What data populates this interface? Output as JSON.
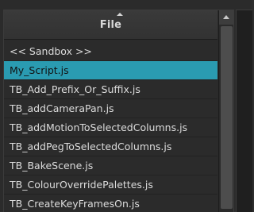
{
  "file_list": {
    "header_title": "File",
    "items": [
      "<< Sandbox >>",
      "My_Script.js",
      "TB_Add_Prefix_Or_Suffix.js",
      "TB_addCameraPan.js",
      "TB_addMotionToSelectedColumns.js",
      "TB_addPegToSelectedColumns.js",
      "TB_BakeScene.js",
      "TB_ColourOverridePalettes.js",
      "TB_CreateKeyFramesOn.js"
    ],
    "selected_index": 1
  },
  "colors": {
    "selection": "#2a9bb1",
    "background": "#2b2b2b",
    "text": "#dcdcdc"
  }
}
